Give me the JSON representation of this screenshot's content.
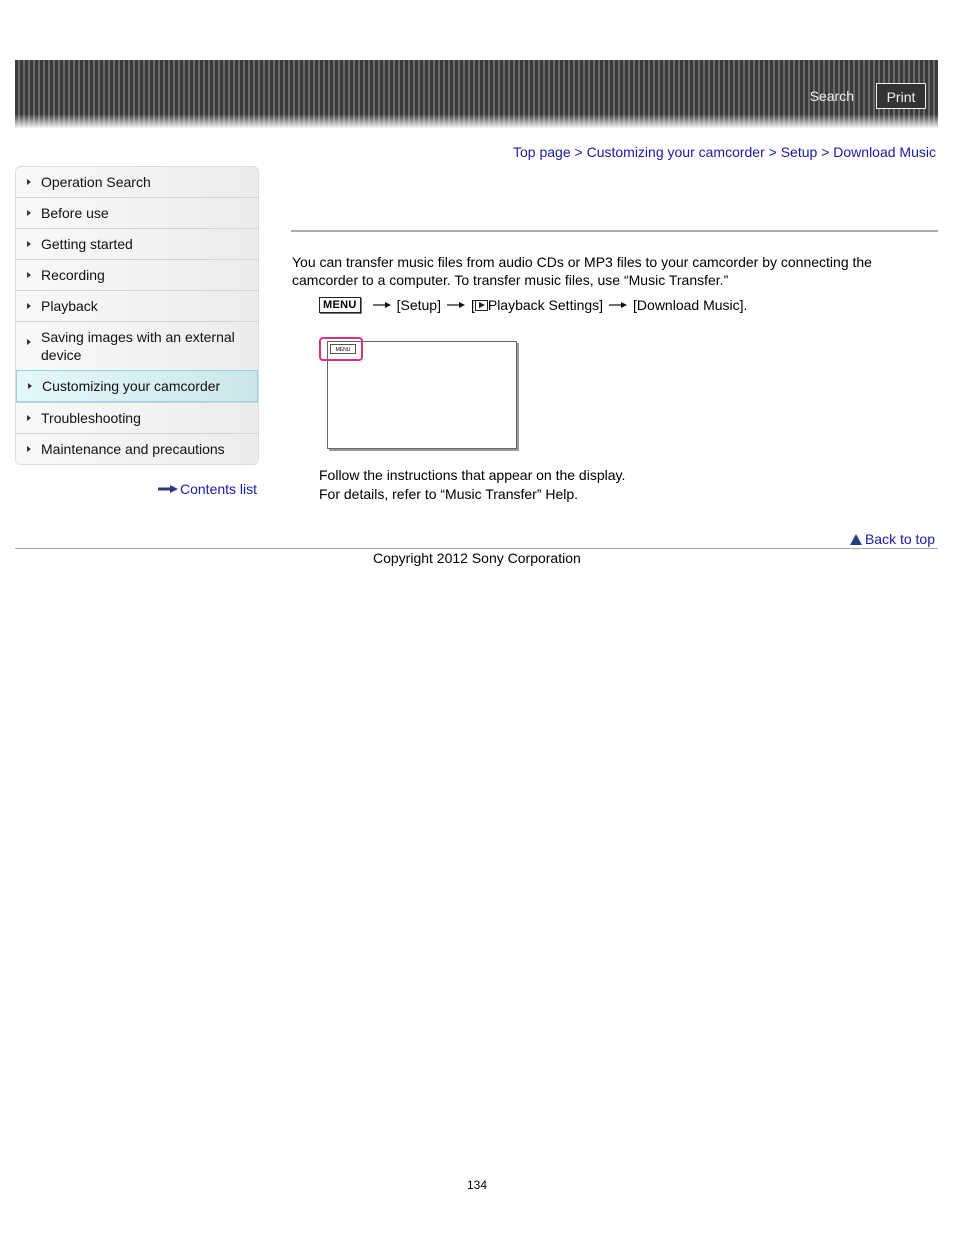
{
  "header": {
    "search_label": "Search",
    "print_label": "Print"
  },
  "breadcrumb": {
    "items": [
      "Top page",
      "Customizing your camcorder",
      "Setup",
      "Download Music"
    ],
    "separator": ">"
  },
  "sidebar": {
    "items": [
      {
        "label": "Operation Search"
      },
      {
        "label": "Before use"
      },
      {
        "label": "Getting started"
      },
      {
        "label": "Recording"
      },
      {
        "label": "Playback"
      },
      {
        "label": "Saving images with an external device"
      },
      {
        "label": "Customizing your camcorder",
        "active": true
      },
      {
        "label": "Troubleshooting"
      },
      {
        "label": "Maintenance and precautions"
      }
    ],
    "contents_list_label": "Contents list"
  },
  "main": {
    "intro": "You can transfer music files from audio CDs or MP3 files to your camcorder by connecting the camcorder to a computer. To transfer music files, use “Music Transfer.”",
    "step": {
      "menu_key": "MENU",
      "setup": "[Setup]",
      "playback_open": "[",
      "playback_settings": "Playback Settings]",
      "download_music": "[Download Music]."
    },
    "screen_menu_label": "MENU",
    "follow_line1": "Follow the instructions that appear on the display.",
    "follow_line2": "For details, refer to “Music Transfer” Help."
  },
  "footer": {
    "back_to_top": "Back to top",
    "copyright": "Copyright 2012 Sony Corporation",
    "page_number": "134"
  },
  "colors": {
    "link": "#1a1aa6",
    "highlight": "#e0307a",
    "active_nav": "#cbe6ea"
  }
}
